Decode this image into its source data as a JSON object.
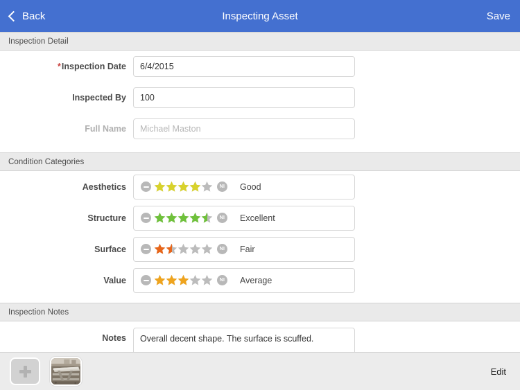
{
  "navbar": {
    "back_label": "Back",
    "title": "Inspecting Asset",
    "save_label": "Save",
    "background_color": "#4470d0",
    "text_color": "#ffffff"
  },
  "sections": {
    "inspection_detail": {
      "header": "Inspection Detail",
      "fields": [
        {
          "label": "Inspection Date",
          "required": true,
          "value": "6/4/2015",
          "placeholder": ""
        },
        {
          "label": "Inspected By",
          "required": false,
          "value": "100",
          "placeholder": ""
        },
        {
          "label": "Full Name",
          "required": false,
          "value": "",
          "placeholder": "Michael Maston",
          "disabled": true
        }
      ]
    },
    "condition_categories": {
      "header": "Condition Categories",
      "minus_icon": "minus-circle-icon",
      "ni_badge_label": "NI",
      "max_stars": 5,
      "rows": [
        {
          "label": "Aesthetics",
          "rating": 4,
          "rating_text": "Good",
          "star_color": "#d8d22c"
        },
        {
          "label": "Structure",
          "rating": 4.5,
          "rating_text": "Excellent",
          "star_color": "#6fc13b"
        },
        {
          "label": "Surface",
          "rating": 1.5,
          "rating_text": "Fair",
          "star_color": "#e8661a"
        },
        {
          "label": "Value",
          "rating": 3,
          "rating_text": "Average",
          "star_color": "#efa41e"
        }
      ],
      "empty_star_color": "#bcbcbc"
    },
    "inspection_notes": {
      "header": "Inspection Notes",
      "label": "Notes",
      "value": "Overall decent shape. The surface is scuffed.",
      "placeholder": ""
    }
  },
  "toolbar": {
    "add_photo_label": "+",
    "photo_thumbnail_alt": "picnic-table-photo",
    "edit_label": "Edit"
  }
}
